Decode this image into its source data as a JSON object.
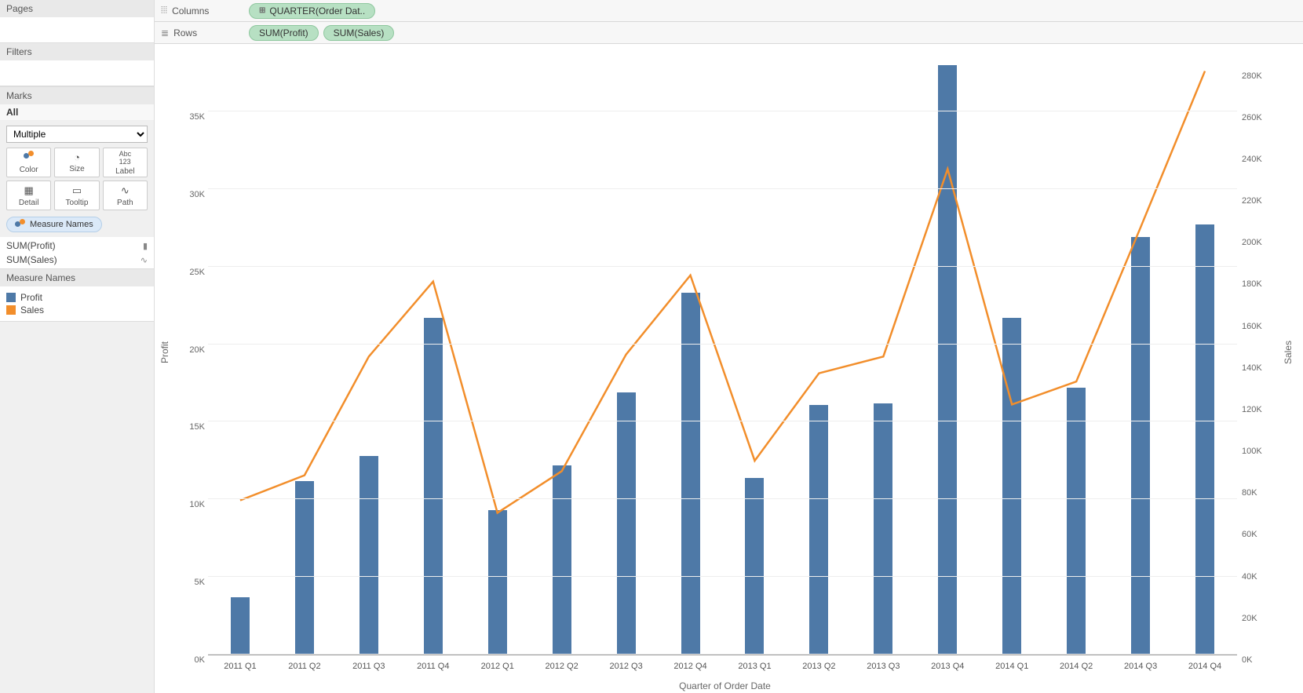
{
  "sidebar": {
    "pages_title": "Pages",
    "filters_title": "Filters",
    "marks_title": "Marks",
    "marks_all": "All",
    "mark_type": "Multiple",
    "mark_buttons": {
      "color": "Color",
      "size": "Size",
      "label": "Label",
      "detail": "Detail",
      "tooltip": "Tooltip",
      "path": "Path"
    },
    "measure_names_pill": "Measure Names",
    "measure_list": [
      {
        "label": "SUM(Profit)",
        "icon": "bar"
      },
      {
        "label": "SUM(Sales)",
        "icon": "line"
      }
    ],
    "legend": {
      "title": "Measure Names",
      "items": [
        {
          "label": "Profit",
          "color": "#4e79a7"
        },
        {
          "label": "Sales",
          "color": "#f28e2b"
        }
      ]
    }
  },
  "shelves": {
    "columns_label": "Columns",
    "rows_label": "Rows",
    "columns": [
      "QUARTER(Order Dat.."
    ],
    "rows": [
      "SUM(Profit)",
      "SUM(Sales)"
    ]
  },
  "chart_data": {
    "type": "bar_line_dual_axis",
    "x_label": "Quarter of Order Date",
    "y_left_label": "Profit",
    "y_right_label": "Sales",
    "categories": [
      "2011 Q1",
      "2011 Q2",
      "2011 Q3",
      "2011 Q4",
      "2012 Q1",
      "2012 Q2",
      "2012 Q3",
      "2012 Q4",
      "2013 Q1",
      "2013 Q2",
      "2013 Q3",
      "2013 Q4",
      "2014 Q1",
      "2014 Q2",
      "2014 Q3",
      "2014 Q4"
    ],
    "series": [
      {
        "name": "Profit",
        "axis": "left",
        "style": "bar",
        "color": "#4e79a7",
        "values": [
          3700,
          11200,
          12800,
          21700,
          9300,
          12200,
          16900,
          23300,
          11400,
          16100,
          16200,
          38000,
          21700,
          17200,
          26900,
          27700
        ]
      },
      {
        "name": "Sales",
        "axis": "right",
        "style": "line",
        "color": "#f28e2b",
        "values": [
          74000,
          86000,
          143000,
          179000,
          68000,
          88000,
          144000,
          182000,
          93000,
          135000,
          143000,
          233000,
          120000,
          131000,
          205000,
          280000
        ]
      }
    ],
    "y_left": {
      "min": 0,
      "max": 39000,
      "ticks": [
        0,
        5000,
        10000,
        15000,
        20000,
        25000,
        30000,
        35000
      ],
      "tick_labels": [
        "0K",
        "5K",
        "10K",
        "15K",
        "20K",
        "25K",
        "30K",
        "35K"
      ]
    },
    "y_right": {
      "min": 0,
      "max": 290000,
      "ticks": [
        0,
        20000,
        40000,
        60000,
        80000,
        100000,
        120000,
        140000,
        160000,
        180000,
        200000,
        220000,
        240000,
        260000,
        280000
      ],
      "tick_labels": [
        "0K",
        "20K",
        "40K",
        "60K",
        "80K",
        "100K",
        "120K",
        "140K",
        "160K",
        "180K",
        "200K",
        "220K",
        "240K",
        "260K",
        "280K"
      ]
    }
  }
}
